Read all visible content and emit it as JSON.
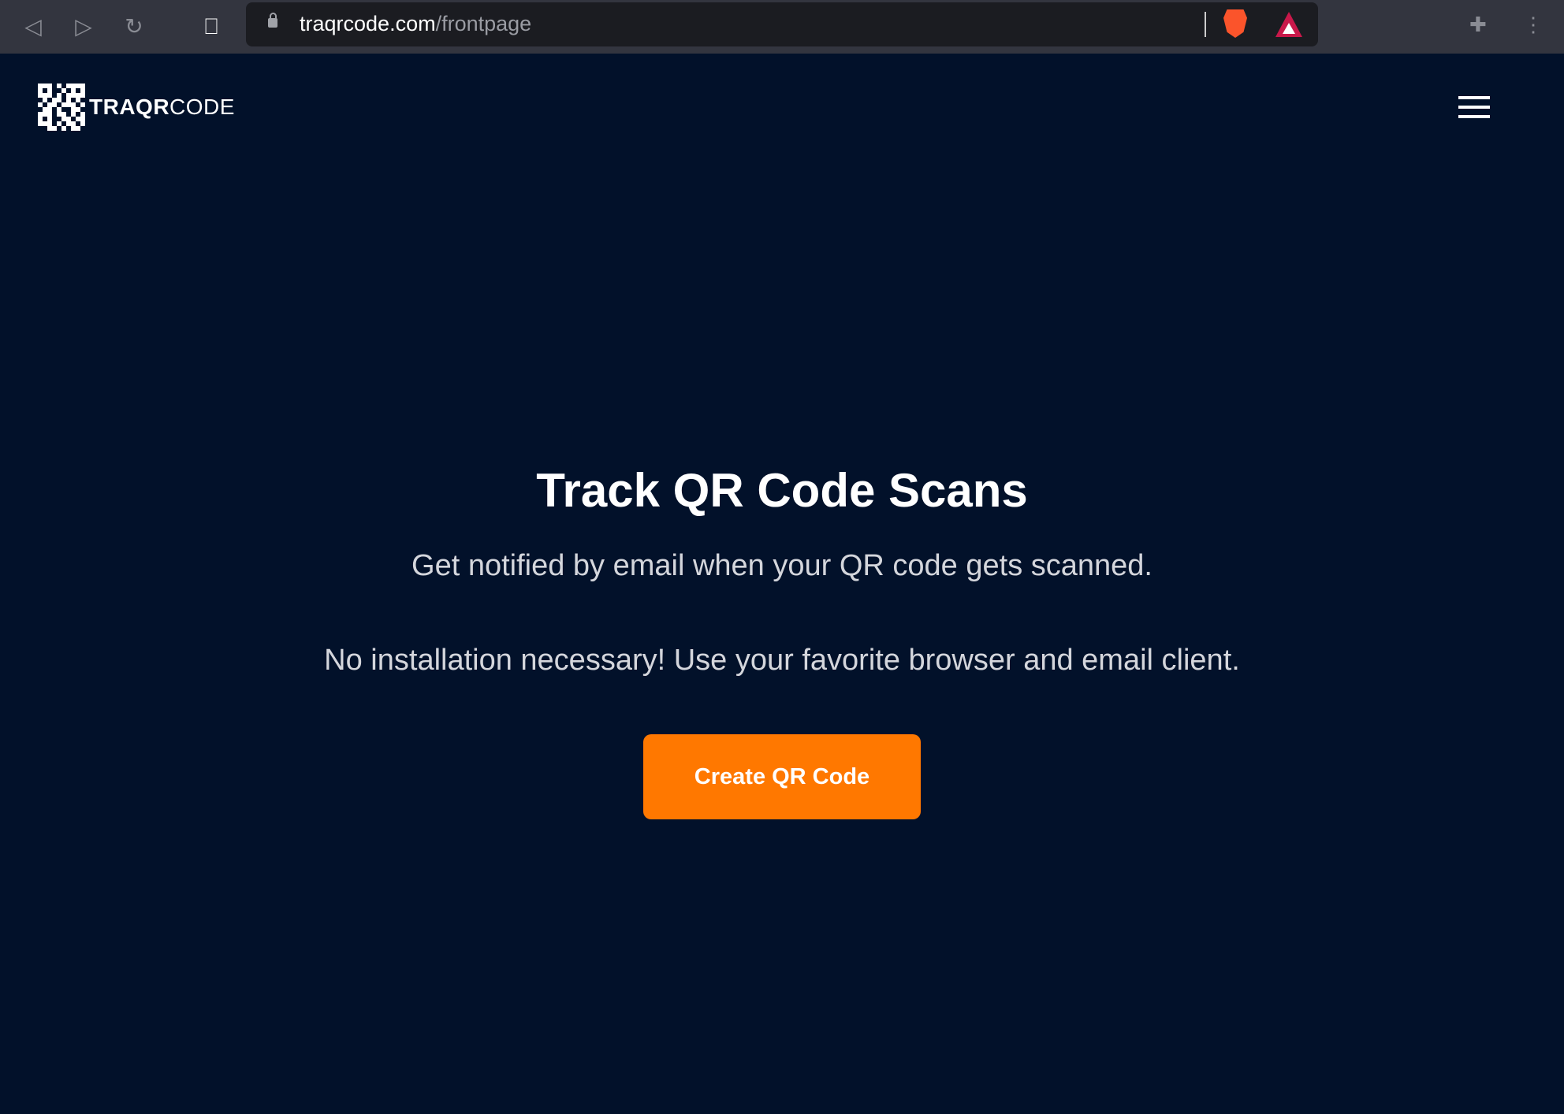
{
  "browser": {
    "url_domain": "traqrcode.com",
    "url_path": "/frontpage"
  },
  "header": {
    "brand_bold": "TRAQR",
    "brand_light": "CODE"
  },
  "hero": {
    "title": "Track QR Code Scans",
    "subtitle": "Get notified by email when your QR code gets scanned.",
    "note": "No installation necessary! Use your favorite browser and email client.",
    "cta_label": "Create QR Code"
  },
  "colors": {
    "background": "#02112a",
    "accent": "#ff7800"
  }
}
